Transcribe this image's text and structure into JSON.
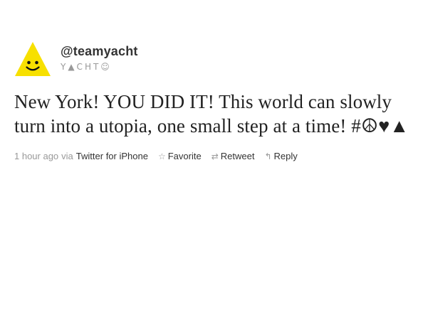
{
  "user": {
    "screen_name": "@teamyacht",
    "full_name": "Y▲CHT☺",
    "avatar_icon": "smiley-triangle-icon",
    "avatar_color": "#f7e000"
  },
  "tweet": {
    "text": "New York! YOU DID IT! This world can slowly turn into a utopia, one small step at a time! #☮♥▲"
  },
  "meta": {
    "timestamp": "1 hour ago",
    "via": "via",
    "source": "Twitter for iPhone"
  },
  "actions": {
    "favorite": {
      "label": "Favorite",
      "icon": "star-icon"
    },
    "retweet": {
      "label": "Retweet",
      "icon": "retweet-icon"
    },
    "reply": {
      "label": "Reply",
      "icon": "reply-icon"
    }
  }
}
